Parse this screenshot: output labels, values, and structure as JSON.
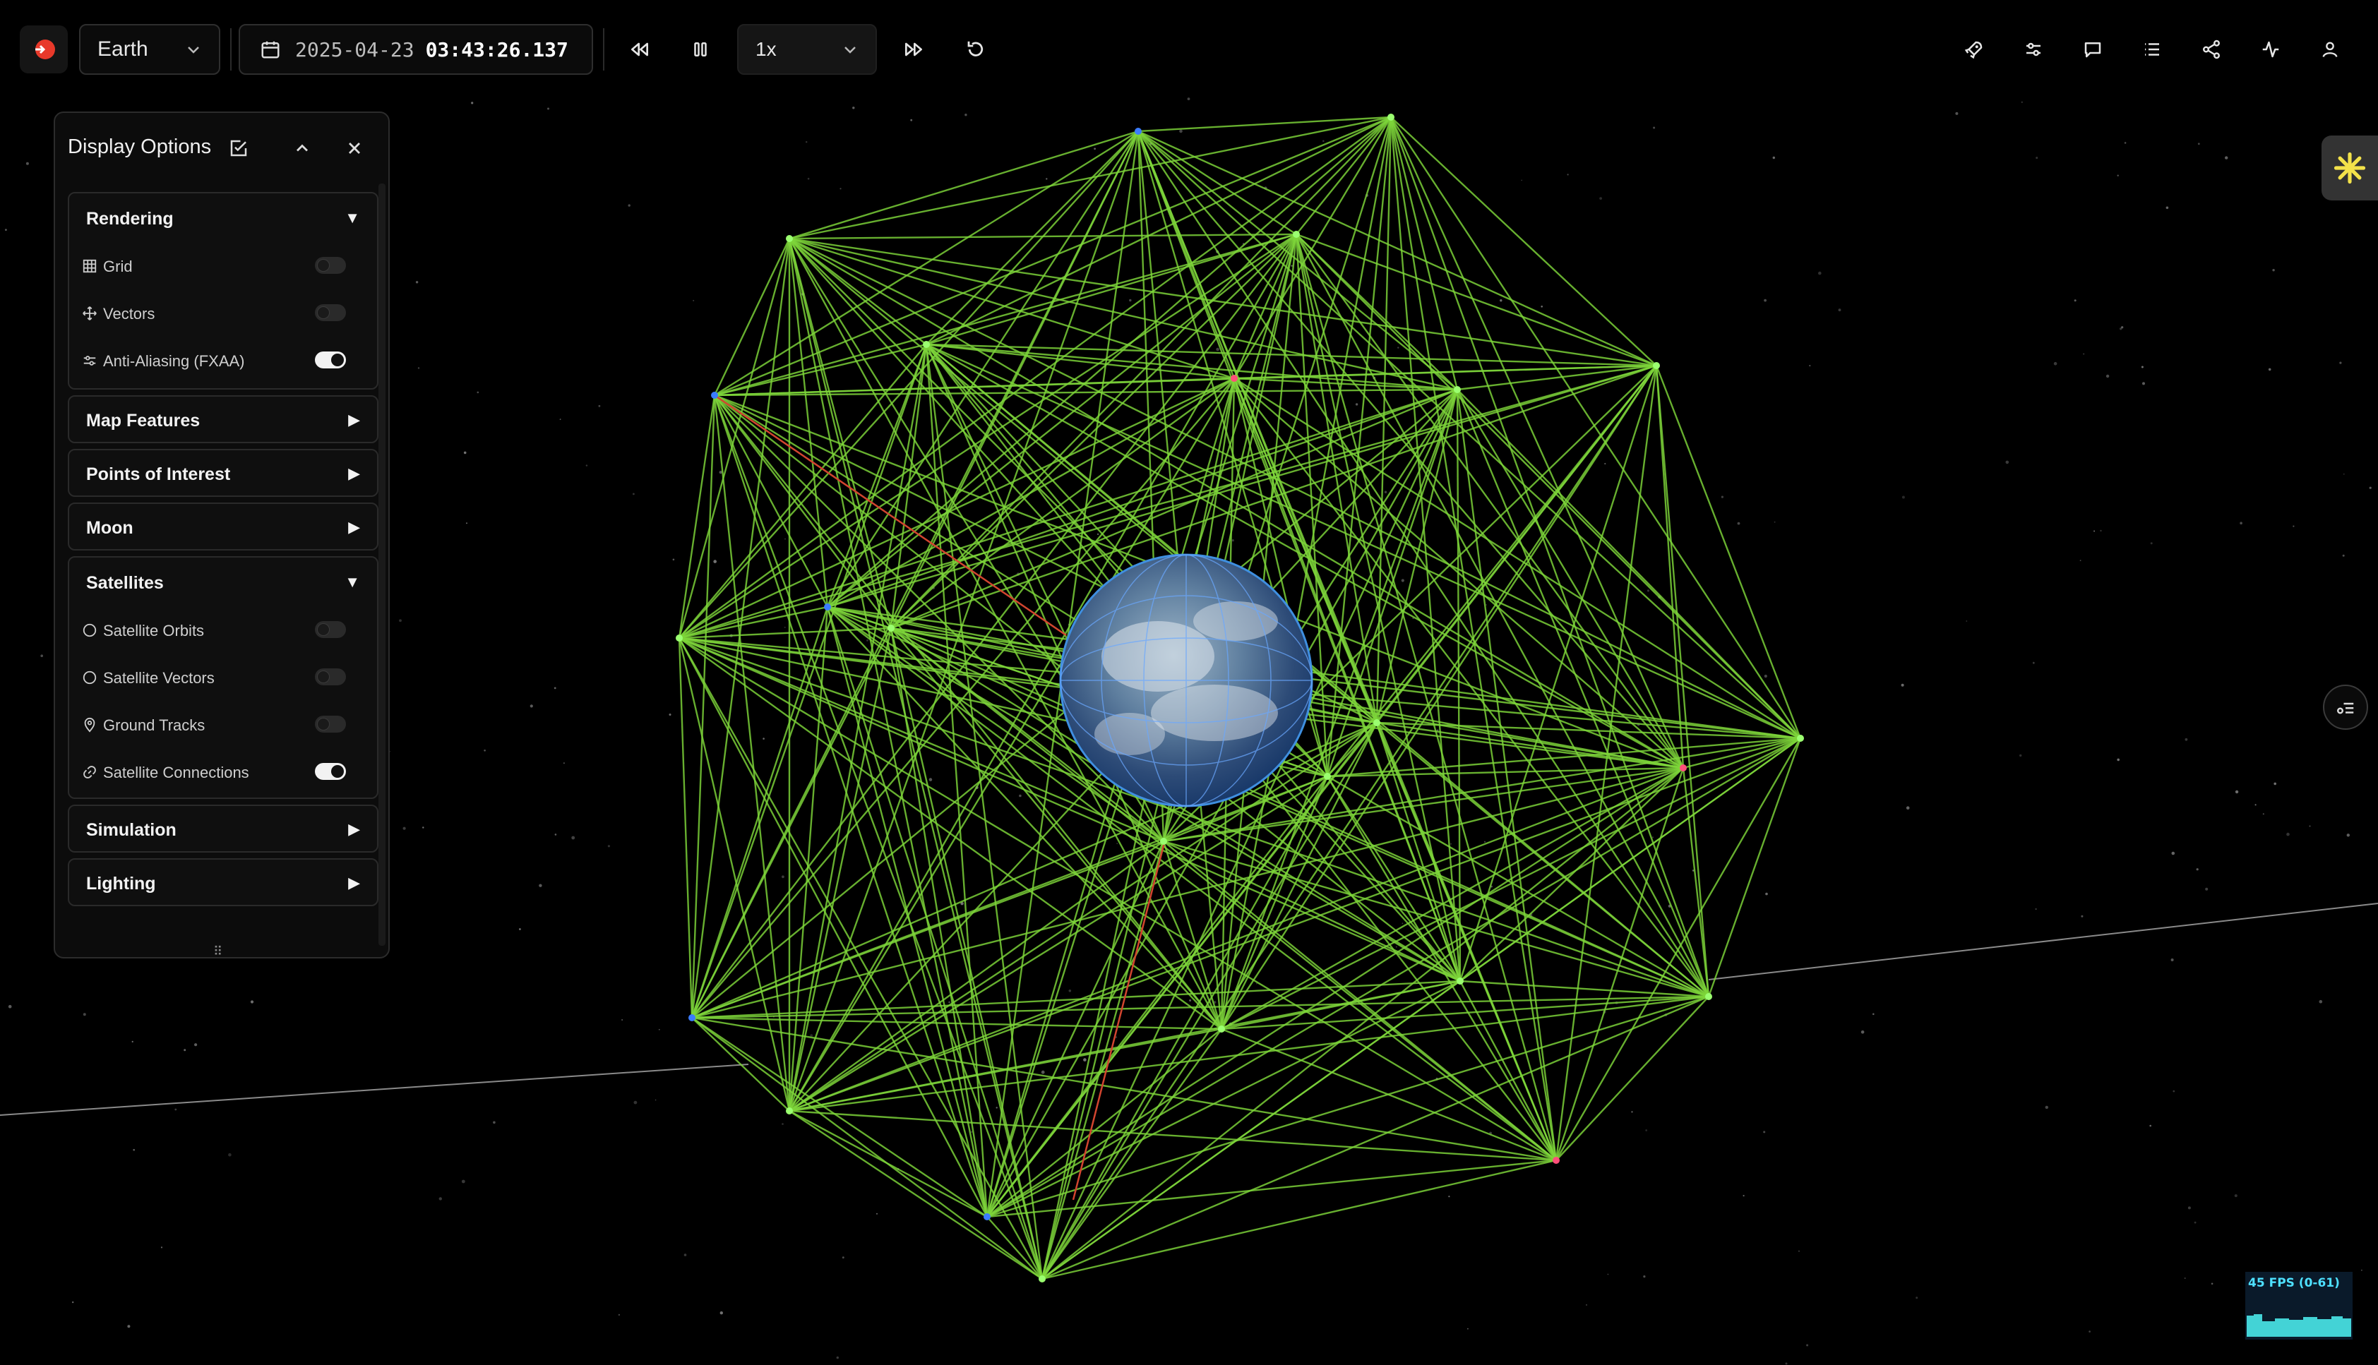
{
  "app": {
    "body_select": "Earth",
    "date": "2025-04-23",
    "time": "03:43:26.137",
    "speed": "1x"
  },
  "colors": {
    "accent": "#e8392a",
    "link_line": "#7ed63a",
    "toggle_on": "#f2f2f2",
    "fps_text": "#4ee0ff",
    "fps_graph": "#43d3d6"
  },
  "toolbar_icons": [
    "rewind-icon",
    "pause-icon",
    "fast-forward-icon",
    "reset-icon",
    "rocket-icon",
    "sliders-icon",
    "chat-icon",
    "list-icon",
    "share-icon",
    "activity-icon",
    "user-icon"
  ],
  "panel": {
    "title": "Display Options",
    "sections": {
      "rendering": {
        "title": "Rendering",
        "expanded": true,
        "items": [
          {
            "label": "Grid",
            "icon": "grid-icon",
            "on": false
          },
          {
            "label": "Vectors",
            "icon": "move-icon",
            "on": false
          },
          {
            "label": "Anti-Aliasing (FXAA)",
            "icon": "sliders-icon",
            "on": true
          }
        ]
      },
      "map_features": {
        "title": "Map Features",
        "expanded": false
      },
      "points_of_interest": {
        "title": "Points of Interest",
        "expanded": false
      },
      "moon": {
        "title": "Moon",
        "expanded": false
      },
      "satellites": {
        "title": "Satellites",
        "expanded": true,
        "items": [
          {
            "label": "Satellite Orbits",
            "icon": "circle-icon",
            "on": false
          },
          {
            "label": "Satellite Vectors",
            "icon": "circle-icon",
            "on": false
          },
          {
            "label": "Ground Tracks",
            "icon": "map-pin-icon",
            "on": false
          },
          {
            "label": "Satellite Connections",
            "icon": "link-icon",
            "on": true
          }
        ]
      },
      "simulation": {
        "title": "Simulation",
        "expanded": false
      },
      "lighting": {
        "title": "Lighting",
        "expanded": false
      }
    }
  },
  "fps": {
    "label": "45 FPS (0-61)"
  }
}
